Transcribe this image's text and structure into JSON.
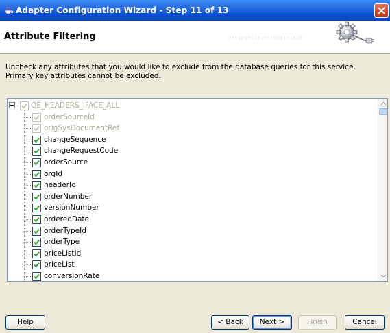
{
  "window": {
    "title": "Adapter Configuration Wizard - Step 11 of 13",
    "close_label": "close"
  },
  "header": {
    "title": "Attribute Filtering",
    "decoration_text": "01010100101001010101010"
  },
  "instructions": "Uncheck any attributes that you would like to exclude from the database queries for this service.  Primary key attributes cannot be excluded.",
  "tree": {
    "root": {
      "label": "OE_HEADERS_IFACE_ALL",
      "checked": true,
      "disabled": true,
      "expanded": true
    },
    "items": [
      {
        "label": "orderSourceId",
        "checked": true,
        "disabled": true
      },
      {
        "label": "origSysDocumentRef",
        "checked": true,
        "disabled": true
      },
      {
        "label": "changeSequence",
        "checked": true,
        "disabled": false
      },
      {
        "label": "changeRequestCode",
        "checked": true,
        "disabled": false
      },
      {
        "label": "orderSource",
        "checked": true,
        "disabled": false
      },
      {
        "label": "orgId",
        "checked": true,
        "disabled": false
      },
      {
        "label": "headerId",
        "checked": true,
        "disabled": false
      },
      {
        "label": "orderNumber",
        "checked": true,
        "disabled": false
      },
      {
        "label": "versionNumber",
        "checked": true,
        "disabled": false
      },
      {
        "label": "orderedDate",
        "checked": true,
        "disabled": false
      },
      {
        "label": "orderTypeId",
        "checked": true,
        "disabled": false
      },
      {
        "label": "orderType",
        "checked": true,
        "disabled": false
      },
      {
        "label": "priceListId",
        "checked": true,
        "disabled": false
      },
      {
        "label": "priceList",
        "checked": true,
        "disabled": false
      },
      {
        "label": "conversionRate",
        "checked": true,
        "disabled": false
      }
    ],
    "scroll_position": 0.0
  },
  "buttons": {
    "help": "Help",
    "back": "< Back",
    "next": "Next >",
    "finish": "Finish",
    "cancel": "Cancel"
  },
  "colors": {
    "title_bar": "#0b4fd4",
    "close_button": "#d44a2a",
    "check_mark": "#21a121",
    "dialog_bg": "#ece9d8"
  }
}
